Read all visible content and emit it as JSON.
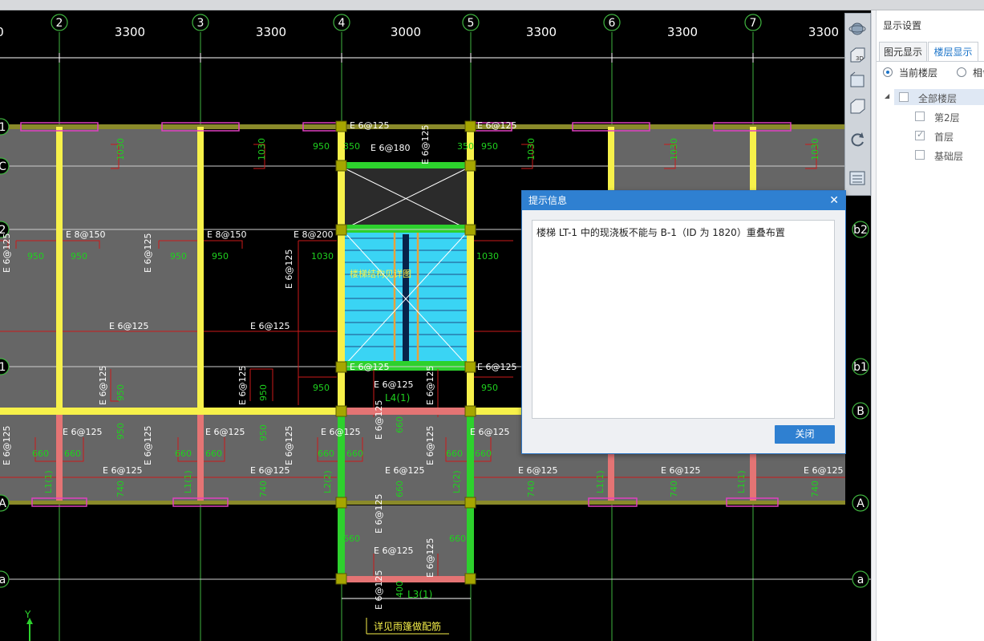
{
  "grid": {
    "axis_numbers": [
      "2",
      "3",
      "4",
      "5",
      "6",
      "7"
    ],
    "span_left": "0",
    "spans": [
      "3300",
      "3300",
      "3000",
      "3300",
      "3300",
      "3300"
    ],
    "row_left": [
      "1",
      "C",
      "2",
      "1",
      "A",
      "a"
    ],
    "row_right": [
      "b2",
      "b1",
      "B",
      "A",
      "a"
    ]
  },
  "annotations": {
    "e8150": "E 8@150",
    "e8200": "E 8@200",
    "e6125": "E 6@125",
    "e6180": "E 6@180",
    "d950": "950",
    "d350": "350",
    "d1030": "1030",
    "d660": "660",
    "d740": "740",
    "d400": "400",
    "l4": "L4(1)",
    "l3": "L3(1)",
    "l2": "L2(2)",
    "l1": "L1(1)",
    "stair_label": "楼梯结构见详图",
    "note": "详见雨篷做配筋",
    "axis_y": "Y"
  },
  "toolbar_icons": [
    "orbit-icon",
    "view-3d-icon",
    "view-top-icon",
    "view-front-icon",
    "rotate-icon",
    "layers-icon"
  ],
  "panel": {
    "title": "显示设置",
    "tabs": [
      "图元显示",
      "楼层显示"
    ],
    "radio_current": "当前楼层",
    "radio_other": "相邻",
    "tree": {
      "root": "全部楼层",
      "items": [
        "第2层",
        "首层",
        "基础层"
      ],
      "checked": [
        false,
        true,
        false
      ]
    }
  },
  "dialog": {
    "title": "提示信息",
    "close_glyph": "✕",
    "message": "楼梯 LT-1 中的现浇板不能与 B-1（ID 为 1820）重叠布置",
    "button": "关闭"
  },
  "colors": {
    "accent": "#2f80d1",
    "beam_yellow": "#f7f14a",
    "beam_green": "#2dd12d",
    "beam_red": "#e47474",
    "slab_gray": "#666666",
    "stair_cyan": "#3ad4f4",
    "rebar_red": "#cc1a1a",
    "dim_green": "#1fd11f"
  }
}
